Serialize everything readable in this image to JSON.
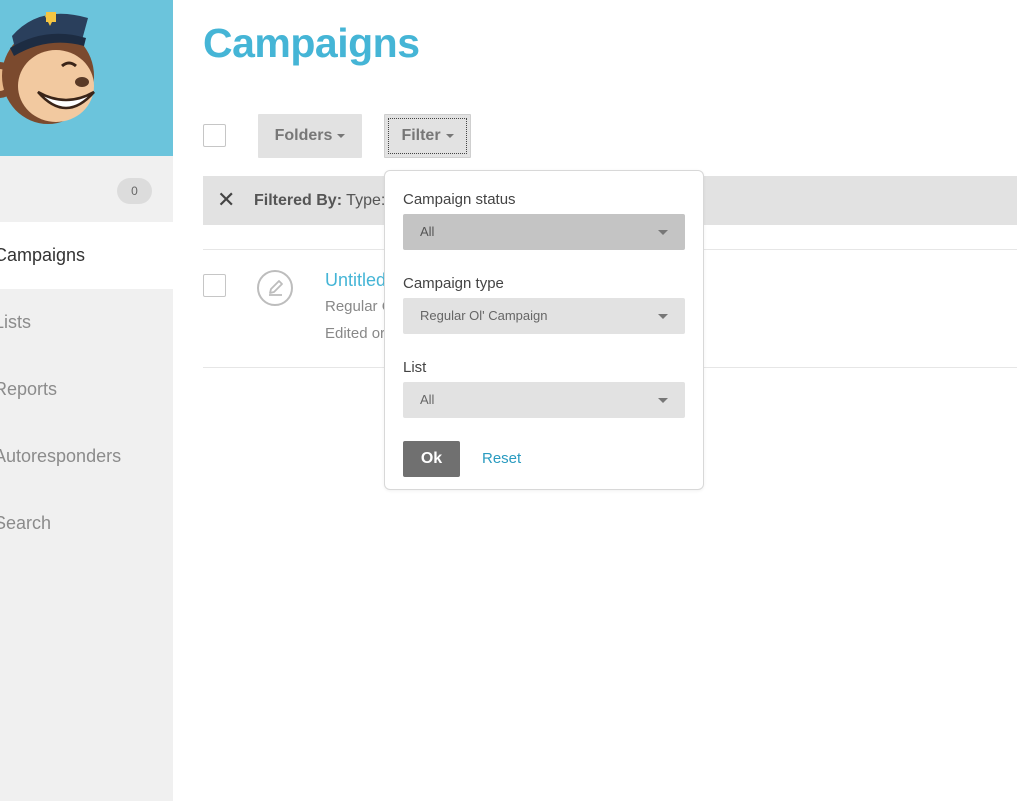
{
  "app": {
    "title": "Campaigns",
    "accent_color": "#45b5d6",
    "brand_color": "#6bc4dc"
  },
  "sidebar": {
    "logo_icon": "monkey-logo-icon",
    "notification_count": "0",
    "items": [
      {
        "label": "Campaigns",
        "active": true
      },
      {
        "label": "Lists",
        "active": false
      },
      {
        "label": "Reports",
        "active": false
      },
      {
        "label": "Autoresponders",
        "active": false
      },
      {
        "label": "Search",
        "active": false
      }
    ]
  },
  "toolbar": {
    "folders_label": "Folders",
    "filter_label": "Filter"
  },
  "filter_bar": {
    "clear_icon": "close-icon",
    "prefix": "Filtered By:",
    "text": "Type:"
  },
  "campaign_row": {
    "icon": "pencil-edit-icon",
    "title": "Untitled",
    "subtitle": "Regular C",
    "edited": "Edited or"
  },
  "filter_popup": {
    "status": {
      "label": "Campaign status",
      "value": "All"
    },
    "type": {
      "label": "Campaign type",
      "value": "Regular Ol' Campaign"
    },
    "list": {
      "label": "List",
      "value": "All"
    },
    "ok_label": "Ok",
    "reset_label": "Reset"
  }
}
